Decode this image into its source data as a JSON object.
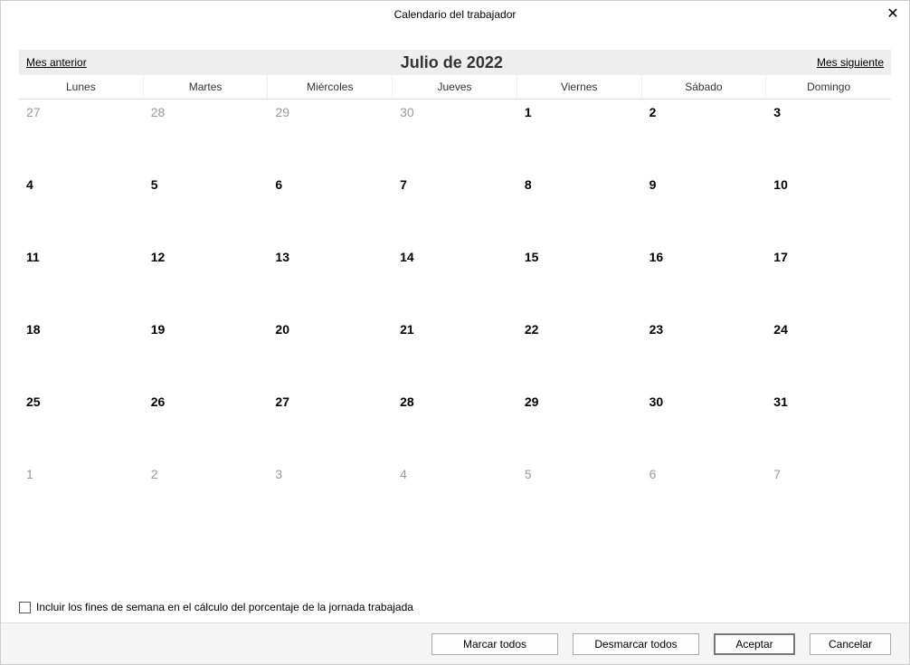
{
  "titlebar": {
    "title": "Calendario del trabajador"
  },
  "nav": {
    "prev": "Mes anterior",
    "next": "Mes siguiente"
  },
  "month_title": "Julio de 2022",
  "weekdays": [
    "Lunes",
    "Martes",
    "Miércoles",
    "Jueves",
    "Viernes",
    "Sábado",
    "Domingo"
  ],
  "days": [
    {
      "n": "27",
      "outside": true
    },
    {
      "n": "28",
      "outside": true
    },
    {
      "n": "29",
      "outside": true
    },
    {
      "n": "30",
      "outside": true
    },
    {
      "n": "1",
      "outside": false
    },
    {
      "n": "2",
      "outside": false
    },
    {
      "n": "3",
      "outside": false
    },
    {
      "n": "4",
      "outside": false
    },
    {
      "n": "5",
      "outside": false
    },
    {
      "n": "6",
      "outside": false
    },
    {
      "n": "7",
      "outside": false
    },
    {
      "n": "8",
      "outside": false
    },
    {
      "n": "9",
      "outside": false
    },
    {
      "n": "10",
      "outside": false
    },
    {
      "n": "11",
      "outside": false
    },
    {
      "n": "12",
      "outside": false
    },
    {
      "n": "13",
      "outside": false
    },
    {
      "n": "14",
      "outside": false
    },
    {
      "n": "15",
      "outside": false
    },
    {
      "n": "16",
      "outside": false
    },
    {
      "n": "17",
      "outside": false
    },
    {
      "n": "18",
      "outside": false
    },
    {
      "n": "19",
      "outside": false
    },
    {
      "n": "20",
      "outside": false
    },
    {
      "n": "21",
      "outside": false
    },
    {
      "n": "22",
      "outside": false
    },
    {
      "n": "23",
      "outside": false
    },
    {
      "n": "24",
      "outside": false
    },
    {
      "n": "25",
      "outside": false
    },
    {
      "n": "26",
      "outside": false
    },
    {
      "n": "27",
      "outside": false
    },
    {
      "n": "28",
      "outside": false
    },
    {
      "n": "29",
      "outside": false
    },
    {
      "n": "30",
      "outside": false
    },
    {
      "n": "31",
      "outside": false
    },
    {
      "n": "1",
      "outside": true
    },
    {
      "n": "2",
      "outside": true
    },
    {
      "n": "3",
      "outside": true
    },
    {
      "n": "4",
      "outside": true
    },
    {
      "n": "5",
      "outside": true
    },
    {
      "n": "6",
      "outside": true
    },
    {
      "n": "7",
      "outside": true
    }
  ],
  "checkbox": {
    "label": "Incluir los fines de semana en el cálculo del porcentaje de la jornada trabajada",
    "checked": false
  },
  "buttons": {
    "mark_all": "Marcar todos",
    "unmark_all": "Desmarcar todos",
    "accept": "Aceptar",
    "cancel": "Cancelar"
  }
}
